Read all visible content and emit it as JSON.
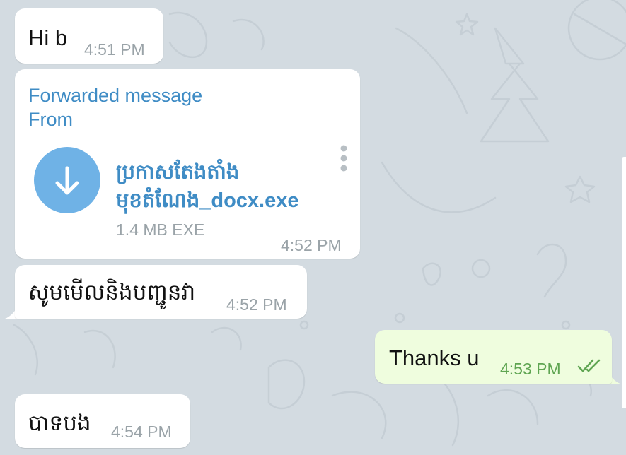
{
  "messages": [
    {
      "text": "Hi b",
      "time": "4:51 PM"
    },
    {
      "forwarded_label": "Forwarded message",
      "from_label": "From",
      "file": {
        "name_line1": "ប្រកាសតែងតាំង",
        "name_line2": "មុខតំណែង_docx.exe",
        "size": "1.4 MB EXE"
      },
      "time": "4:52 PM"
    },
    {
      "text": "សូមមើលនិងបញ្ជូនវា",
      "time": "4:52 PM"
    },
    {
      "text": "Thanks u",
      "time": "4:53 PM",
      "status": "read-double-check"
    },
    {
      "text": "បាទបង",
      "time": "4:54 PM"
    }
  ],
  "colors": {
    "background": "#d3dbe1",
    "incoming_bubble": "#ffffff",
    "outgoing_bubble": "#effdde",
    "accent": "#3f8cc5",
    "file_circle": "#6fb2e6",
    "outgoing_time": "#5fa552",
    "timestamp": "#9aa3a8"
  },
  "icons": {
    "download": "download-arrow-icon",
    "menu": "more-vertical-icon",
    "read_receipt": "double-check-icon"
  }
}
